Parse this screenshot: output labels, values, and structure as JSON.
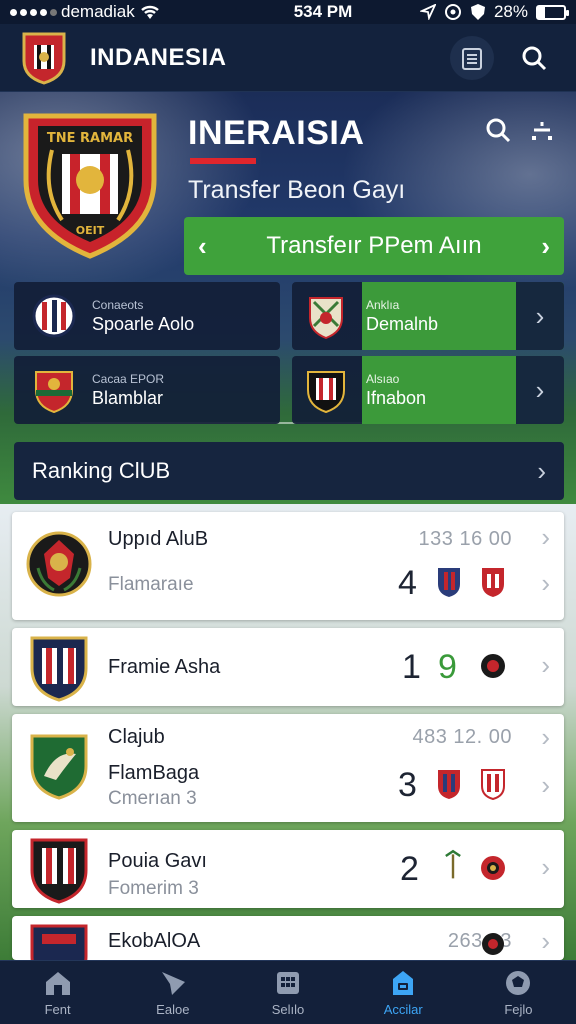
{
  "status_bar": {
    "carrier": "demadiak",
    "time": "534 PM",
    "battery": "28%",
    "battery_level": 0.28
  },
  "header": {
    "title": "INDANESIA"
  },
  "hero": {
    "crest_text_top": "TNE RAMAR",
    "crest_text_bottom": "OEIT",
    "title": "INERAISIA",
    "subtitle": "Transfer Beon Gayı",
    "transfer_button": "Transfeır PPem  Aıın"
  },
  "club_cards": [
    {
      "small": "Conaeots",
      "name": "Spoarle Aolo"
    },
    {
      "small": "Anklıa",
      "name": "Demalnb"
    },
    {
      "small": "Cacaa EPOR",
      "name": "Blamblar"
    },
    {
      "small": "Alsıao",
      "name": "Ifnabon"
    }
  ],
  "ranking": {
    "header": "Ranking ClUB",
    "rows": [
      {
        "name": "Uppıd AluB",
        "sub": "Flamaraıe",
        "stats": "133  16    00",
        "position": "4"
      },
      {
        "name": "Framie Asha",
        "sub": "",
        "stats": "",
        "position": "1",
        "extra": "9"
      },
      {
        "name": "Clajub",
        "name2": "FlamBaga",
        "sub": "Cmerıan 3",
        "stats": "483  12.    00",
        "position": "3"
      },
      {
        "name": "Pouia Gavı",
        "sub": "Fomerim 3",
        "stats": "",
        "position": "2"
      },
      {
        "name": "EkobAlOA",
        "sub": "",
        "stats": "263  23",
        "position": ""
      }
    ]
  },
  "bottom_nav": [
    {
      "label": "Fent",
      "icon": "home-icon"
    },
    {
      "label": "Ealoe",
      "icon": "send-icon"
    },
    {
      "label": "Selılo",
      "icon": "calendar-icon"
    },
    {
      "label": "Accilar",
      "icon": "lock-icon",
      "active": true
    },
    {
      "label": "Fejlo",
      "icon": "ball-icon"
    }
  ],
  "colors": {
    "accent_green": "#3fa23b",
    "accent_red": "#e0262d",
    "nav_active": "#3da5f5"
  }
}
